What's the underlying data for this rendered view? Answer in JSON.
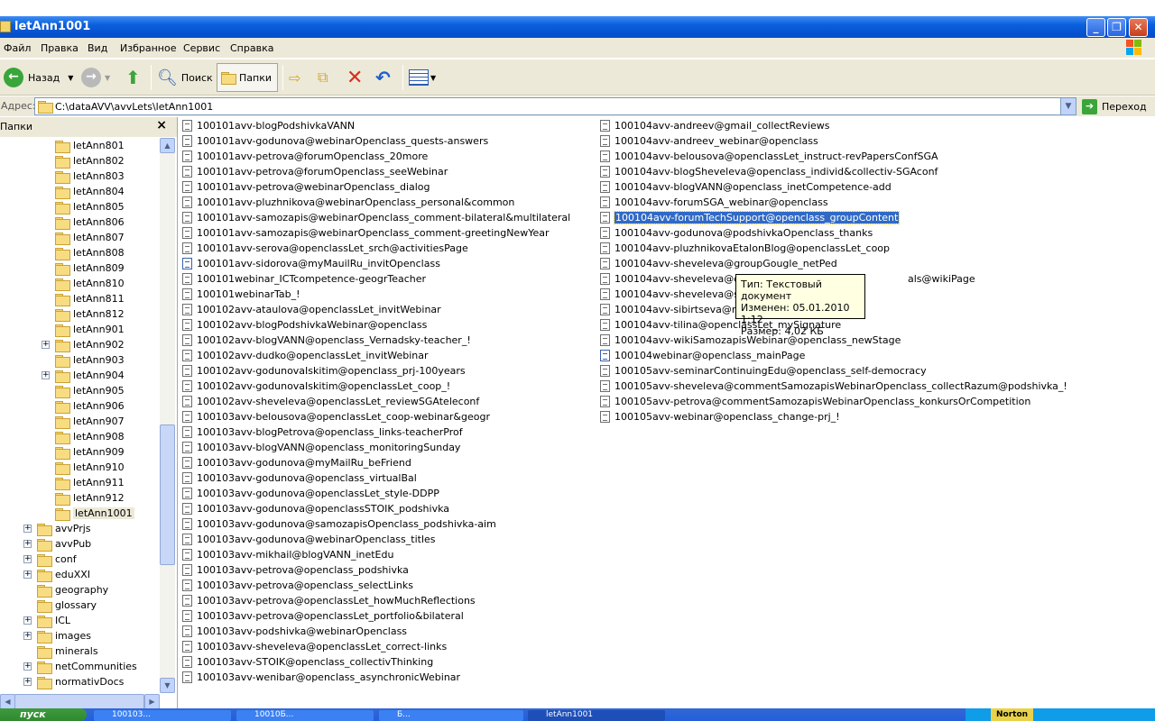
{
  "window": {
    "title": "letAnn1001"
  },
  "menu": [
    "Файл",
    "Правка",
    "Вид",
    "Избранное",
    "Сервис",
    "Справка"
  ],
  "toolbar": {
    "back": "Назад",
    "search": "Поиск",
    "folders": "Папки"
  },
  "address": {
    "label": "Адрес:",
    "path": "C:\\dataAVV\\avvLets\\letAnn1001",
    "go": "Переход"
  },
  "tree": {
    "header": "Папки",
    "close_glyph": "×",
    "items": [
      {
        "label": "letAnn801",
        "indent": 3,
        "plus": false
      },
      {
        "label": "letAnn802",
        "indent": 3,
        "plus": false
      },
      {
        "label": "letAnn803",
        "indent": 3,
        "plus": false
      },
      {
        "label": "letAnn804",
        "indent": 3,
        "plus": false
      },
      {
        "label": "letAnn805",
        "indent": 3,
        "plus": false
      },
      {
        "label": "letAnn806",
        "indent": 3,
        "plus": false
      },
      {
        "label": "letAnn807",
        "indent": 3,
        "plus": false
      },
      {
        "label": "letAnn808",
        "indent": 3,
        "plus": false
      },
      {
        "label": "letAnn809",
        "indent": 3,
        "plus": false
      },
      {
        "label": "letAnn810",
        "indent": 3,
        "plus": false
      },
      {
        "label": "letAnn811",
        "indent": 3,
        "plus": false
      },
      {
        "label": "letAnn812",
        "indent": 3,
        "plus": false
      },
      {
        "label": "letAnn901",
        "indent": 3,
        "plus": false
      },
      {
        "label": "letAnn902",
        "indent": 3,
        "plus": true
      },
      {
        "label": "letAnn903",
        "indent": 3,
        "plus": false
      },
      {
        "label": "letAnn904",
        "indent": 3,
        "plus": true
      },
      {
        "label": "letAnn905",
        "indent": 3,
        "plus": false
      },
      {
        "label": "letAnn906",
        "indent": 3,
        "plus": false
      },
      {
        "label": "letAnn907",
        "indent": 3,
        "plus": false
      },
      {
        "label": "letAnn908",
        "indent": 3,
        "plus": false
      },
      {
        "label": "letAnn909",
        "indent": 3,
        "plus": false
      },
      {
        "label": "letAnn910",
        "indent": 3,
        "plus": false
      },
      {
        "label": "letAnn911",
        "indent": 3,
        "plus": false
      },
      {
        "label": "letAnn912",
        "indent": 3,
        "plus": false
      },
      {
        "label": "letAnn1001",
        "indent": 3,
        "plus": false,
        "selected": true
      },
      {
        "label": "avvPrjs",
        "indent": 2,
        "plus": true
      },
      {
        "label": "avvPub",
        "indent": 2,
        "plus": true
      },
      {
        "label": "conf",
        "indent": 2,
        "plus": true
      },
      {
        "label": "eduXXI",
        "indent": 2,
        "plus": true
      },
      {
        "label": "geography",
        "indent": 2,
        "plus": false
      },
      {
        "label": "glossary",
        "indent": 2,
        "plus": false
      },
      {
        "label": "ICL",
        "indent": 2,
        "plus": true
      },
      {
        "label": "images",
        "indent": 2,
        "plus": true
      },
      {
        "label": "minerals",
        "indent": 2,
        "plus": false
      },
      {
        "label": "netCommunities",
        "indent": 2,
        "plus": true
      },
      {
        "label": "normativDocs",
        "indent": 2,
        "plus": true
      }
    ]
  },
  "files": {
    "col1": [
      {
        "name": "100101avv-blogPodshivkaVANN"
      },
      {
        "name": "100101avv-godunova@webinarOpenclass_quests-answers"
      },
      {
        "name": "100101avv-petrova@forumOpenclass_20more"
      },
      {
        "name": "100101avv-petrova@forumOpenclass_seeWebinar"
      },
      {
        "name": "100101avv-petrova@webinarOpenclass_dialog"
      },
      {
        "name": "100101avv-pluzhnikova@webinarOpenclass_personal&common"
      },
      {
        "name": "100101avv-samozapis@webinarOpenclass_comment-bilateral&multilateral"
      },
      {
        "name": "100101avv-samozapis@webinarOpenclass_comment-greetingNewYear"
      },
      {
        "name": "100101avv-serova@openclassLet_srch@activitiesPage"
      },
      {
        "name": "100101avv-sidorova@myMauilRu_invitOpenclass",
        "word": true
      },
      {
        "name": "100101webinar_ICTcompetence-geogrTeacher"
      },
      {
        "name": "100101webinarTab_!"
      },
      {
        "name": "100102avv-ataulova@openclassLet_invitWebinar"
      },
      {
        "name": "100102avv-blogPodshivkaWebinar@openclass"
      },
      {
        "name": "100102avv-blogVANN@openclass_Vernadsky-teacher_!"
      },
      {
        "name": "100102avv-dudko@openclassLet_invitWebinar"
      },
      {
        "name": "100102avv-godunovaIskitim@openclass_prj-100years"
      },
      {
        "name": "100102avv-godunovaIskitim@openclassLet_coop_!"
      },
      {
        "name": "100102avv-sheveleva@openclassLet_reviewSGAteleconf"
      },
      {
        "name": "100103avv-belousova@openclassLet_coop-webinar&geogr"
      },
      {
        "name": "100103avv-blogPetrova@openclass_links-teacherProf"
      },
      {
        "name": "100103avv-blogVANN@openclass_monitoringSunday"
      },
      {
        "name": "100103avv-godunova@myMailRu_beFriend"
      },
      {
        "name": "100103avv-godunova@openclass_virtualBal"
      },
      {
        "name": "100103avv-godunova@openclassLet_style-DDPP"
      },
      {
        "name": "100103avv-godunova@openclassSTOIK_podshivka"
      },
      {
        "name": "100103avv-godunova@samozapisOpenclass_podshivka-aim"
      },
      {
        "name": "100103avv-godunova@webinarOpenclass_titles"
      },
      {
        "name": "100103avv-mikhail@blogVANN_inetEdu"
      },
      {
        "name": "100103avv-petrova@openclass_podshivka"
      },
      {
        "name": "100103avv-petrova@openclass_selectLinks"
      },
      {
        "name": "100103avv-petrova@openclassLet_howMuchReflections"
      },
      {
        "name": "100103avv-petrova@openclassLet_portfolio&bilateral"
      },
      {
        "name": "100103avv-podshivka@webinarOpenclass"
      },
      {
        "name": "100103avv-sheveleva@openclassLet_correct-links"
      },
      {
        "name": "100103avv-STOIK@openclass_collectivThinking"
      },
      {
        "name": "100103avv-wenibar@openclass_asynchronicWebinar"
      }
    ],
    "col2": [
      {
        "name": "100104avv-andreev@gmail_collectReviews"
      },
      {
        "name": "100104avv-andreev_webinar@openclass"
      },
      {
        "name": "100104avv-belousova@openclassLet_instruct-revPapersConfSGA"
      },
      {
        "name": "100104avv-blogSheveleva@openclass_individ&collectiv-SGAconf"
      },
      {
        "name": "100104avv-blogVANN@openclass_inetCompetence-add"
      },
      {
        "name": "100104avv-forumSGA_webinar@openclass"
      },
      {
        "name": "100104avv-forumTechSupport@openclass_groupContent",
        "selected": true
      },
      {
        "name": "100104avv-godunova@podshivkaOpenclass_thanks"
      },
      {
        "name": "100104avv-pluzhnikovaEtalonBlog@openclassLet_coop"
      },
      {
        "name": "100104avv-sheveleva@groupGougle_netPed"
      },
      {
        "name": "100104avv-sheveleva@ope",
        "tail": "als@wikiPage"
      },
      {
        "name": "100104avv-sheveleva@sam"
      },
      {
        "name": "100104avv-sibirtseva@myM"
      },
      {
        "name": "100104avv-tilina@openclassLet_mySignature"
      },
      {
        "name": "100104avv-wikiSamozapisWebinar@openclass_newStage"
      },
      {
        "name": "100104webinar@openclass_mainPage",
        "word": true
      },
      {
        "name": "100105avv-seminarContinuingEdu@openclass_self-democracy"
      },
      {
        "name": "100105avv-sheveleva@commentSamozapisWebinarOpenclass_collectRazum@podshivka_!"
      },
      {
        "name": "100105avv-petrova@commentSamozapisWebinarOpenclass_konkursOrCompetition"
      },
      {
        "name": "100105avv-webinar@openclass_change-prj_!"
      }
    ]
  },
  "tooltip": {
    "type": "Тип: Текстовый документ",
    "modified": "Изменен: 05.01.2010 1:12",
    "size": "Размер: 4,02 КБ"
  },
  "taskbar": {
    "start": "пуск",
    "tasks": [
      "100103...",
      "10010Б...",
      "Б...",
      "letAnn1001"
    ],
    "tray": "Norton"
  }
}
